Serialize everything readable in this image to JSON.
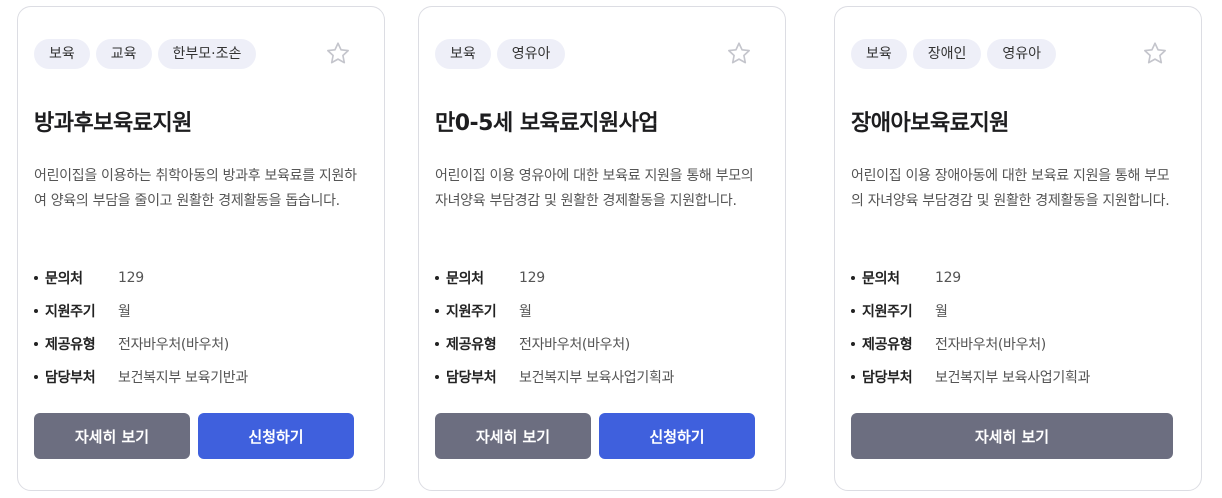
{
  "colors": {
    "detail_button": "#6c6e80",
    "apply_button": "#3f60dd",
    "tag_bg": "#eeeff8"
  },
  "icons": {
    "favorite": "star-outline-icon"
  },
  "cards": [
    {
      "tags": [
        "보육",
        "교육",
        "한부모·조손"
      ],
      "title": "방과후보육료지원",
      "description": "어린이집을 이용하는 취학아동의 방과후 보육료를 지원하여 양육의 부담을 줄이고 원활한 경제활동을 돕습니다.",
      "info": [
        {
          "label": "문의처",
          "value": "129"
        },
        {
          "label": "지원주기",
          "value": "월"
        },
        {
          "label": "제공유형",
          "value": "전자바우처(바우처)"
        },
        {
          "label": "담당부처",
          "value": "보건복지부 보육기반과"
        }
      ],
      "detail_label": "자세히 보기",
      "apply_label": "신청하기"
    },
    {
      "tags": [
        "보육",
        "영유아"
      ],
      "title": "만0-5세 보육료지원사업",
      "description": "어린이집 이용 영유아에 대한 보육료 지원을 통해 부모의 자녀양육 부담경감 및 원활한 경제활동을 지원합니다.",
      "info": [
        {
          "label": "문의처",
          "value": "129"
        },
        {
          "label": "지원주기",
          "value": "월"
        },
        {
          "label": "제공유형",
          "value": "전자바우처(바우처)"
        },
        {
          "label": "담당부처",
          "value": "보건복지부 보육사업기획과"
        }
      ],
      "detail_label": "자세히 보기",
      "apply_label": "신청하기"
    },
    {
      "tags": [
        "보육",
        "장애인",
        "영유아"
      ],
      "title": "장애아보육료지원",
      "description": "어린이집 이용 장애아동에 대한 보육료 지원을 통해 부모의 자녀양육 부담경감 및 원활한 경제활동을 지원합니다.",
      "info": [
        {
          "label": "문의처",
          "value": "129"
        },
        {
          "label": "지원주기",
          "value": "월"
        },
        {
          "label": "제공유형",
          "value": "전자바우처(바우처)"
        },
        {
          "label": "담당부처",
          "value": "보건복지부 보육사업기획과"
        }
      ],
      "detail_label": "자세히 보기"
    }
  ]
}
